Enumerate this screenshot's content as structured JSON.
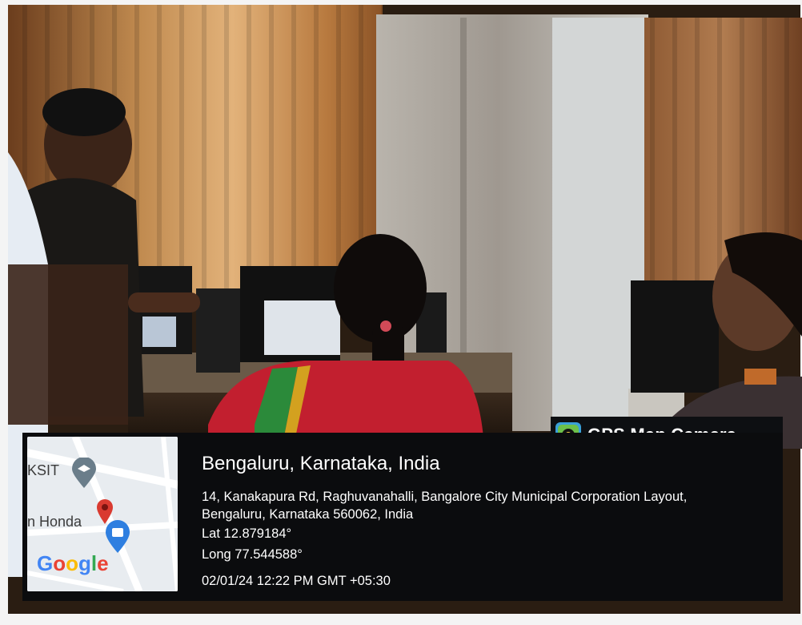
{
  "watermark": {
    "app_name": "GPS Map Camera",
    "city_line": "Bengaluru, Karnataka, India",
    "address_line_1": "14, Kanakapura Rd, Raghuvanahalli, Bangalore City Municipal Corporation Layout,",
    "address_line_2": "Bengaluru, Karnataka 560062, India",
    "latitude": "Lat 12.879184°",
    "longitude": "Long 77.544588°",
    "timestamp": "02/01/24 12:22 PM GMT +05:30"
  },
  "map": {
    "place_label_1": "KSIT",
    "place_label_2": "n Honda",
    "brand": "Google"
  }
}
